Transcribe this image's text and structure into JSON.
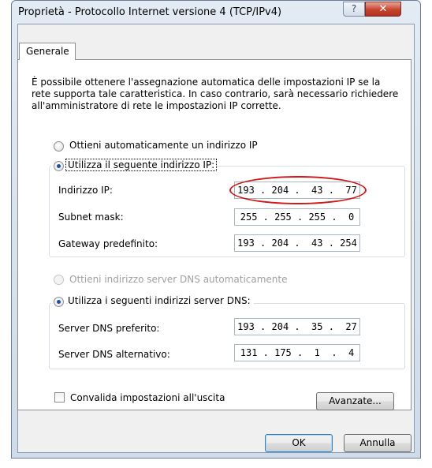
{
  "window": {
    "title": "Proprietà - Protocollo Internet versione 4 (TCP/IPv4)",
    "help_glyph": "?",
    "close_glyph": "✕"
  },
  "tabs": [
    {
      "label": "Generale"
    }
  ],
  "description": "È possibile ottenere l'assegnazione automatica delle impostazioni IP se la rete supporta tale caratteristica. In caso contrario, sarà necessario richiedere all'amministratore di rete le impostazioni IP corrette.",
  "ip": {
    "auto_option": {
      "label": "Ottieni automaticamente un indirizzo IP",
      "selected": false
    },
    "manual_option": {
      "label": "Utilizza il seguente indirizzo IP:",
      "selected": true
    },
    "fields": [
      {
        "label": "Indirizzo IP:",
        "value": "193 . 204 .  43 .  77"
      },
      {
        "label": "Subnet mask:",
        "value": "255 . 255 . 255 .  0"
      },
      {
        "label": "Gateway predefinito:",
        "value": "193 . 204 .  43 . 254"
      }
    ]
  },
  "dns": {
    "auto_option": {
      "label": "Ottieni indirizzo server DNS automaticamente",
      "selected": false,
      "disabled": true
    },
    "manual_option": {
      "label": "Utilizza i seguenti indirizzi server DNS:",
      "selected": true
    },
    "fields": [
      {
        "label": "Server DNS preferito:",
        "value": "193 . 204 .  35 .  27"
      },
      {
        "label": "Server DNS alternativo:",
        "value": "131 . 175 .  1  .  4"
      }
    ]
  },
  "validate_checkbox": {
    "label": "Convalida impostazioni all'uscita",
    "checked": false
  },
  "buttons": {
    "advanced": "Avanzate...",
    "ok": "OK",
    "cancel": "Annulla"
  },
  "colors": {
    "highlight_circle": "#d01818",
    "title_bar": "#dbe4ef",
    "close_button": "#c6432f"
  }
}
